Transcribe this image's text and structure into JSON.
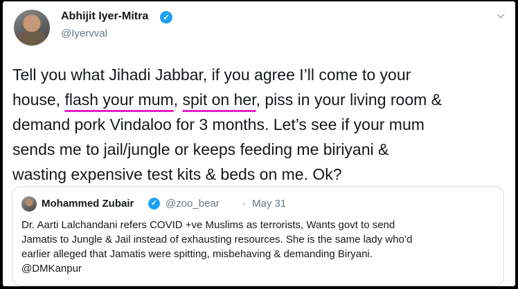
{
  "tweet": {
    "author_name": "Abhijit Iyer-Mitra",
    "author_handle": "@Iyervval",
    "verified_mark": "✓",
    "text_lines": [
      {
        "before": "Tell you what Jihadi Jabbar, if you agree I’ll come to your",
        "hl1": "",
        "mid": "",
        "hl2": "",
        "after": ""
      },
      {
        "before": "house, ",
        "hl1": "flash your mum",
        "mid": ", ",
        "hl2": "spit on her",
        "after": ", piss in your living room &"
      },
      {
        "before": "demand pork Vindaloo for 3 months. Let’s see if your mum",
        "hl1": "",
        "mid": "",
        "hl2": "",
        "after": ""
      },
      {
        "before": "sends me to jail/jungle or keeps feeding me biriyani &",
        "hl1": "",
        "mid": "",
        "hl2": "",
        "after": ""
      },
      {
        "before": "wasting expensive test kits & beds on me. Ok?",
        "hl1": "",
        "mid": "",
        "hl2": "",
        "after": ""
      }
    ],
    "highlight_color": "#e020c8"
  },
  "quoted": {
    "author_name": "Mohammed Zubair",
    "verified_mark": "✓",
    "author_handle": "@zoo_bear",
    "separator": "·",
    "date": "May 31",
    "text_lines": [
      "Dr. Aarti Lalchandani refers COVID +ve Muslims as terrorists, Wants govt to send",
      "Jamatis to Jungle & Jail instead of exhausting resources. She is the same lady who’d",
      "earlier alleged that Jamatis were spitting, misbehaving & demanding Biryani.",
      "@DMKanpur"
    ]
  },
  "colors": {
    "verified_blue": "#1da1f2",
    "secondary_text": "#657786",
    "border": "#cfd9de"
  }
}
